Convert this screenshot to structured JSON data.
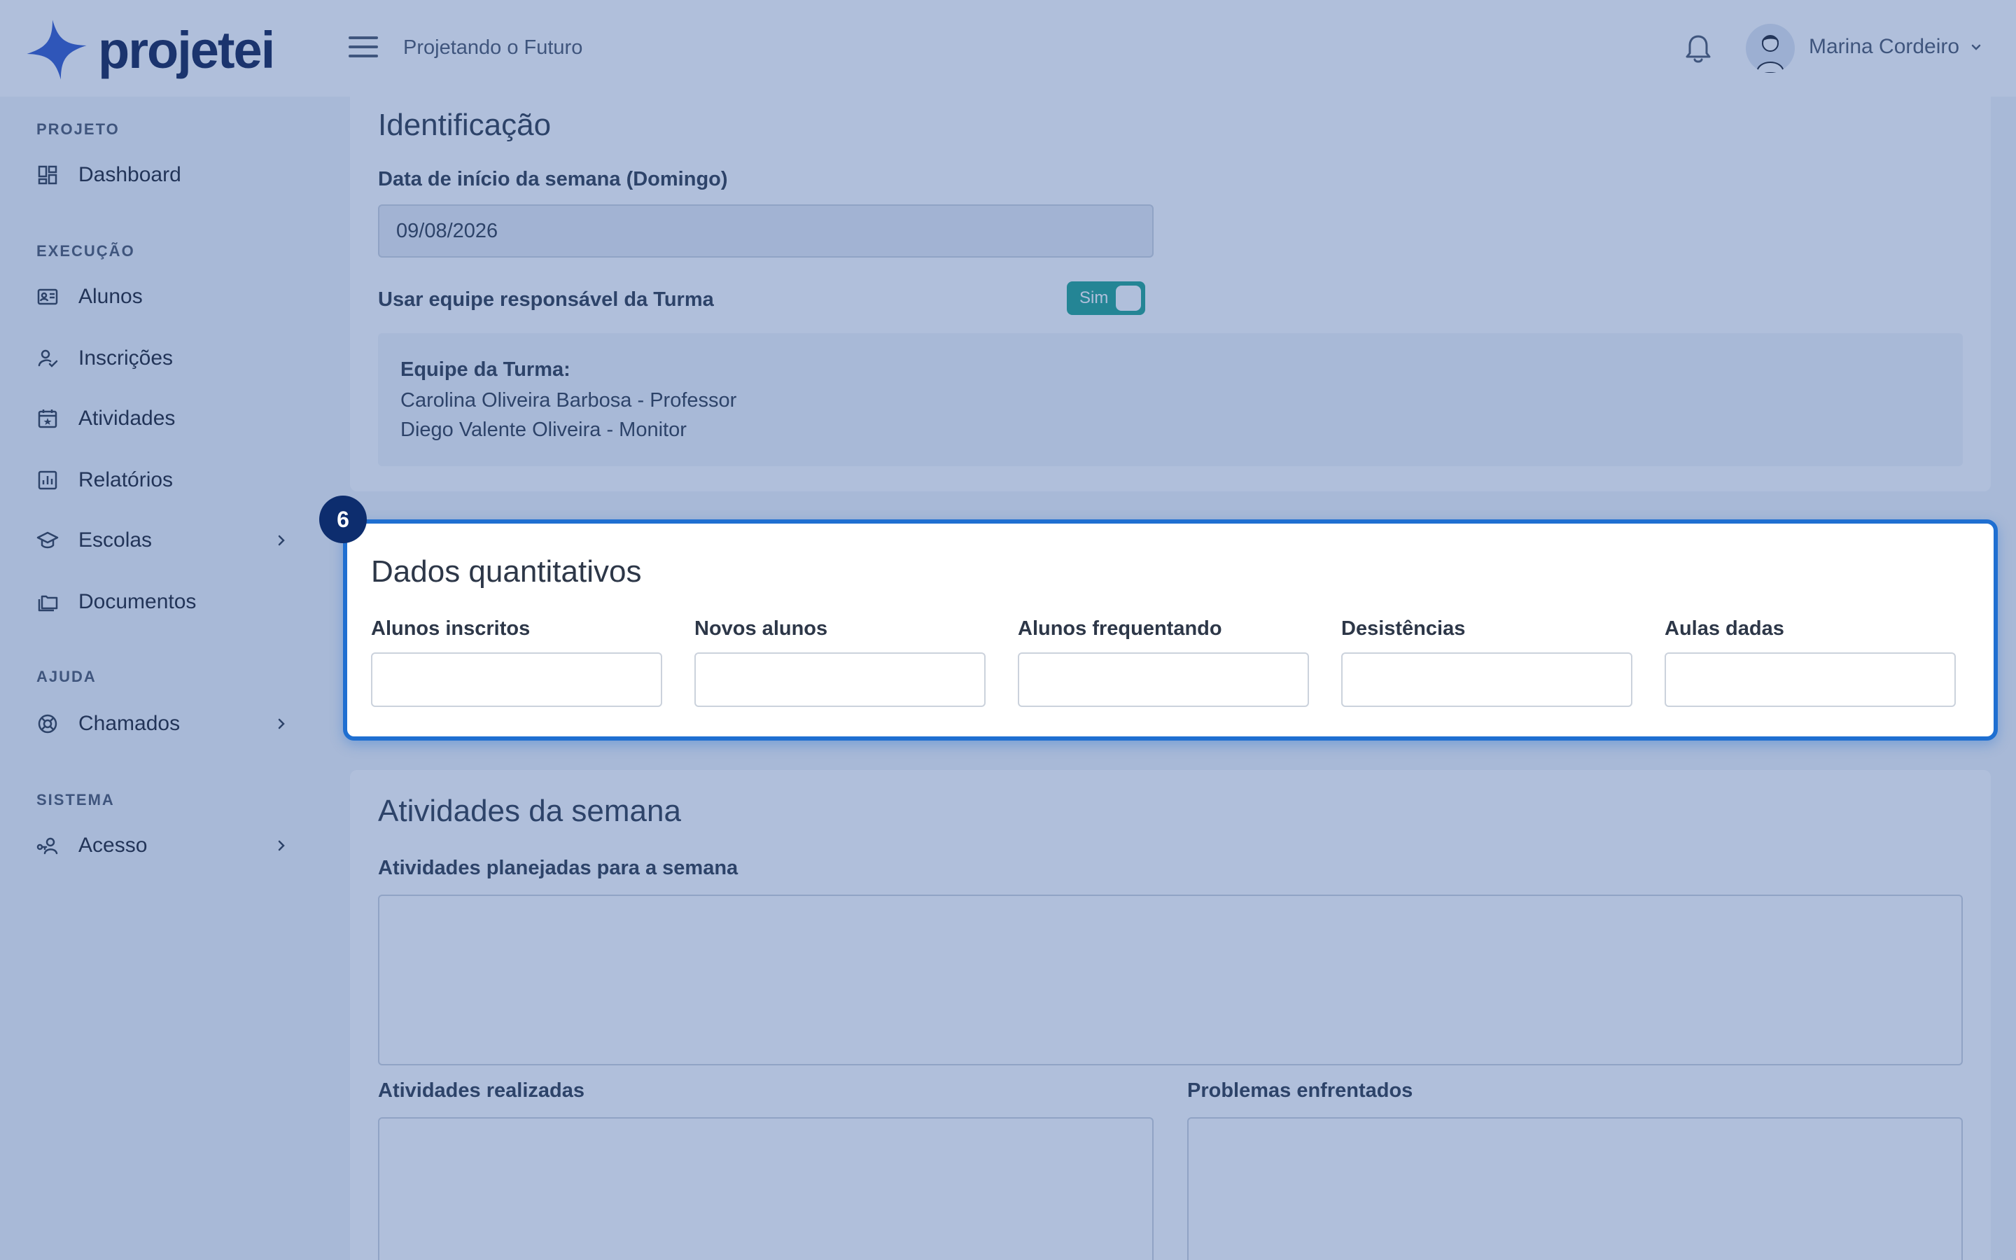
{
  "app": {
    "brand": "projetei",
    "project_name": "Projetando o Futuro",
    "user_name": "Marina Cordeiro"
  },
  "colors": {
    "brand_blue": "#2f56c8",
    "brand_text": "#0f1f4f",
    "toggle_green": "#1ea28e",
    "highlight_border": "#1f6fd1",
    "badge": "#0d2d6e"
  },
  "sidebar": {
    "sections": [
      {
        "title": "PROJETO",
        "items": [
          {
            "label": "Dashboard",
            "icon": "dashboard-icon"
          }
        ]
      },
      {
        "title": "EXECUÇÃO",
        "items": [
          {
            "label": "Alunos",
            "icon": "id-card-icon"
          },
          {
            "label": "Inscrições",
            "icon": "user-check-icon"
          },
          {
            "label": "Atividades",
            "icon": "calendar-star-icon"
          },
          {
            "label": "Relatórios",
            "icon": "bar-chart-icon"
          },
          {
            "label": "Escolas",
            "icon": "graduation-cap-icon",
            "has_children": true
          },
          {
            "label": "Documentos",
            "icon": "folders-icon"
          }
        ]
      },
      {
        "title": "AJUDA",
        "items": [
          {
            "label": "Chamados",
            "icon": "lifebuoy-icon",
            "has_children": true
          }
        ]
      },
      {
        "title": "SISTEMA",
        "items": [
          {
            "label": "Acesso",
            "icon": "user-key-icon",
            "has_children": true
          }
        ]
      }
    ]
  },
  "identificacao": {
    "title": "Identificação",
    "week_start_label": "Data de início da semana (Domingo)",
    "week_start_value": "09/08/2026",
    "use_team_label": "Usar equipe responsável da Turma",
    "toggle_label": "Sim",
    "toggle_on": true,
    "team_title": "Equipe da Turma:",
    "team_members": [
      "Carolina Oliveira Barbosa - Professor",
      "Diego Valente Oliveira - Monitor"
    ]
  },
  "quantitativos": {
    "step": "6",
    "title": "Dados quantitativos",
    "fields": [
      {
        "label": "Alunos inscritos",
        "value": ""
      },
      {
        "label": "Novos alunos",
        "value": ""
      },
      {
        "label": "Alunos frequentando",
        "value": ""
      },
      {
        "label": "Desistências",
        "value": ""
      },
      {
        "label": "Aulas dadas",
        "value": ""
      }
    ]
  },
  "atividades": {
    "title": "Atividades da semana",
    "planned_label": "Atividades planejadas para a semana",
    "done_label": "Atividades realizadas",
    "problems_label": "Problemas enfrentados"
  }
}
